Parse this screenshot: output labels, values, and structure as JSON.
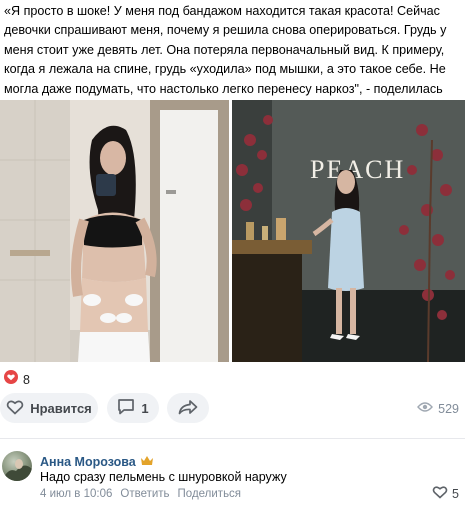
{
  "post": {
    "text": "«Я просто в шоке! У меня под бандажом находится такая красота! Сейчас девочки спрашивают меня, почему я решила снова оперироваться. Грудь у меня стоит уже девять лет. Она потеряла первоначальный вид. К примеру, когда я лежала на спине, грудь «уходила» под мышки, а это такое себе. Не могла даже подумать, что настолько легко перенесу наркоз\", - поделилась Вика.",
    "photo_right_sign": "PEACH"
  },
  "reactions": {
    "count": "8",
    "icon": "heart-icon",
    "color": "#e64646"
  },
  "actions": {
    "like_label": "Нравится",
    "comments_count": "1",
    "views_count": "529"
  },
  "comment": {
    "author": "Анна Морозова",
    "badge_icon": "crown-icon",
    "text": "Надо сразу пельмень с шнуровкой наружу",
    "date": "4 июл в 10:06",
    "reply_label": "Ответить",
    "share_label": "Поделиться",
    "likes": "5"
  },
  "colors": {
    "link": "#2a5885",
    "muted": "#818c99",
    "pill_bg": "#f0f2f5"
  }
}
